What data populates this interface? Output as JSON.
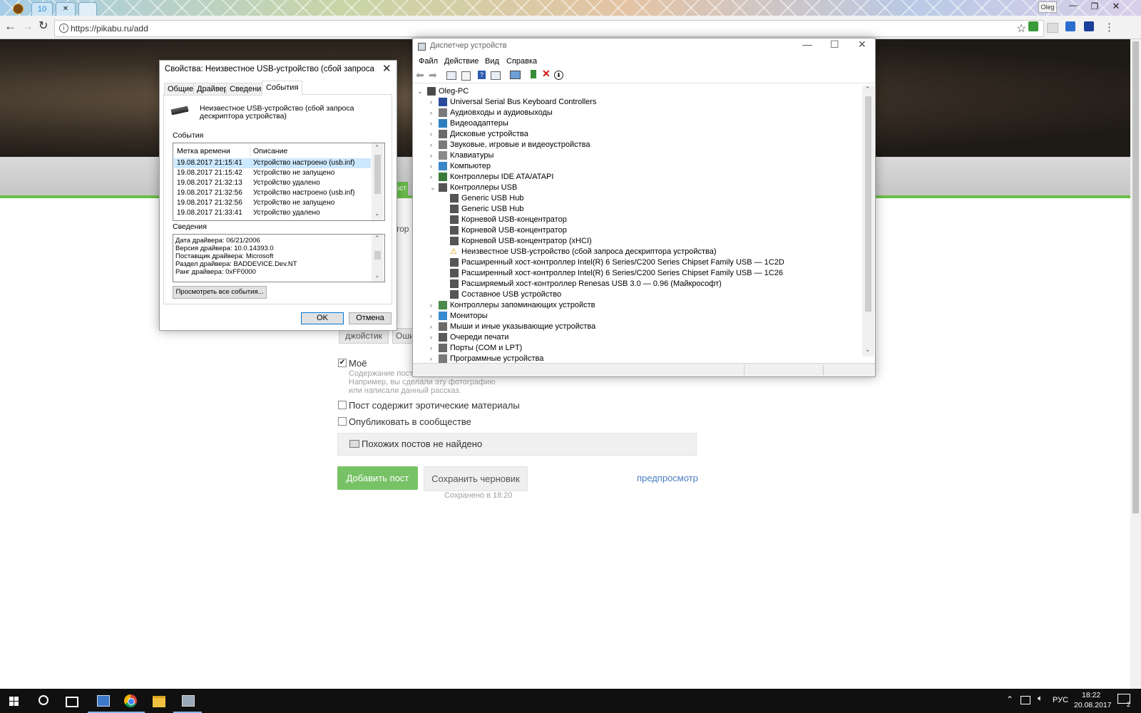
{
  "browser": {
    "tab_counter": "10",
    "url": "https://pikabu.ru/add",
    "profile_name": "Oleg"
  },
  "webpage": {
    "fragments": {
      "green_tab": "ост",
      "behind_label": "итор",
      "tag_chip_1": "джойстик",
      "tag_chip_2": "Оши"
    },
    "mine_checkbox": {
      "label": "Моё",
      "checked": true
    },
    "mine_hint": [
      "Содержание пост",
      "Например, вы сделали эту фотографию",
      "или написали данный рассказ."
    ],
    "erotic_checkbox": {
      "label": "Пост содержит эротические материалы",
      "checked": false
    },
    "community_checkbox": {
      "label": "Опубликовать в сообществе",
      "checked": false
    },
    "similar_posts": "Похожих постов не найдено",
    "add_post_button": "Добавить пост",
    "save_draft_button": "Сохранить черновик",
    "preview_link": "предпросмотр",
    "saved_at": "Сохранено в 18:20",
    "colors": {
      "accent_green": "#78c266",
      "link_blue": "#4a7fc1"
    }
  },
  "properties_dialog": {
    "title": "Свойства: Неизвестное USB-устройство (сбой запроса дескрип...",
    "tabs": [
      "Общие",
      "Драйвер",
      "Сведения",
      "События"
    ],
    "active_tab": "События",
    "device_name": "Неизвестное USB-устройство (сбой запроса дескриптора устройства)",
    "events_label": "События",
    "columns": [
      "Метка времени",
      "Описание"
    ],
    "events": [
      {
        "time": "19.08.2017 21:15:41",
        "desc": "Устройство настроено (usb.inf)"
      },
      {
        "time": "19.08.2017 21:15:42",
        "desc": "Устройство не запущено"
      },
      {
        "time": "19.08.2017 21:32:13",
        "desc": "Устройство удалено"
      },
      {
        "time": "19.08.2017 21:32:56",
        "desc": "Устройство настроено (usb.inf)"
      },
      {
        "time": "19.08.2017 21:32:56",
        "desc": "Устройство не запущено"
      },
      {
        "time": "19.08.2017 21:33:41",
        "desc": "Устройство удалено"
      }
    ],
    "details_label": "Сведения",
    "details": [
      "Дата драйвера: 06/21/2006",
      "Версия драйвера: 10.0.14393.0",
      "Поставщик драйвера: Microsoft",
      "Раздел драйвера: BADDEVICE.Dev.NT",
      "Ранг драйвера: 0xFF0000"
    ],
    "view_all_button": "Просмотреть все события...",
    "ok_button": "OK",
    "cancel_button": "Отмена"
  },
  "device_manager": {
    "title": "Диспетчер устройств",
    "menu": [
      "Файл",
      "Действие",
      "Вид",
      "Справка"
    ],
    "root": "Oleg-PC",
    "categories_before": [
      {
        "label": "Universal Serial Bus Keyboard Controllers",
        "icon": "keyboard-controller-icon"
      },
      {
        "label": "Аудиовходы и аудиовыходы",
        "icon": "speaker-icon"
      },
      {
        "label": "Видеоадаптеры",
        "icon": "display-adapter-icon"
      },
      {
        "label": "Дисковые устройства",
        "icon": "disk-drive-icon"
      },
      {
        "label": "Звуковые, игровые и видеоустройства",
        "icon": "speaker-icon"
      },
      {
        "label": "Клавиатуры",
        "icon": "keyboard-icon"
      },
      {
        "label": "Компьютер",
        "icon": "computer-icon"
      },
      {
        "label": "Контроллеры IDE ATA/ATAPI",
        "icon": "ide-controller-icon"
      }
    ],
    "usb_category": "Контроллеры USB",
    "usb_children": [
      {
        "label": "Generic USB Hub",
        "warning": false
      },
      {
        "label": "Generic USB Hub",
        "warning": false
      },
      {
        "label": "Корневой USB-концентратор",
        "warning": false
      },
      {
        "label": "Корневой USB-концентратор",
        "warning": false
      },
      {
        "label": "Корневой USB-концентратор (xHCI)",
        "warning": false
      },
      {
        "label": "Неизвестное USB-устройство (сбой запроса дескриптора устройства)",
        "warning": true
      },
      {
        "label": "Расширенный хост-контроллер Intel(R) 6 Series/C200 Series Chipset Family USB — 1C2D",
        "warning": false
      },
      {
        "label": "Расширенный хост-контроллер Intel(R) 6 Series/C200 Series Chipset Family USB — 1C26",
        "warning": false
      },
      {
        "label": "Расширяемый хост-контроллер Renesas USB 3.0 — 0.96 (Майкрософт)",
        "warning": false
      },
      {
        "label": "Составное USB устройство",
        "warning": false
      }
    ],
    "categories_after": [
      {
        "label": "Контроллеры запоминающих устройств",
        "icon": "storage-controller-icon"
      },
      {
        "label": "Мониторы",
        "icon": "monitor-icon"
      },
      {
        "label": "Мыши и иные указывающие устройства",
        "icon": "mouse-icon"
      },
      {
        "label": "Очереди печати",
        "icon": "printer-icon"
      },
      {
        "label": "Порты (COM и LPT)",
        "icon": "port-icon"
      },
      {
        "label": "Программные устройства",
        "icon": "software-device-icon"
      }
    ]
  },
  "taskbar": {
    "language": "РУС",
    "time": "18:22",
    "date": "20.08.2017",
    "notification_count": "2"
  }
}
